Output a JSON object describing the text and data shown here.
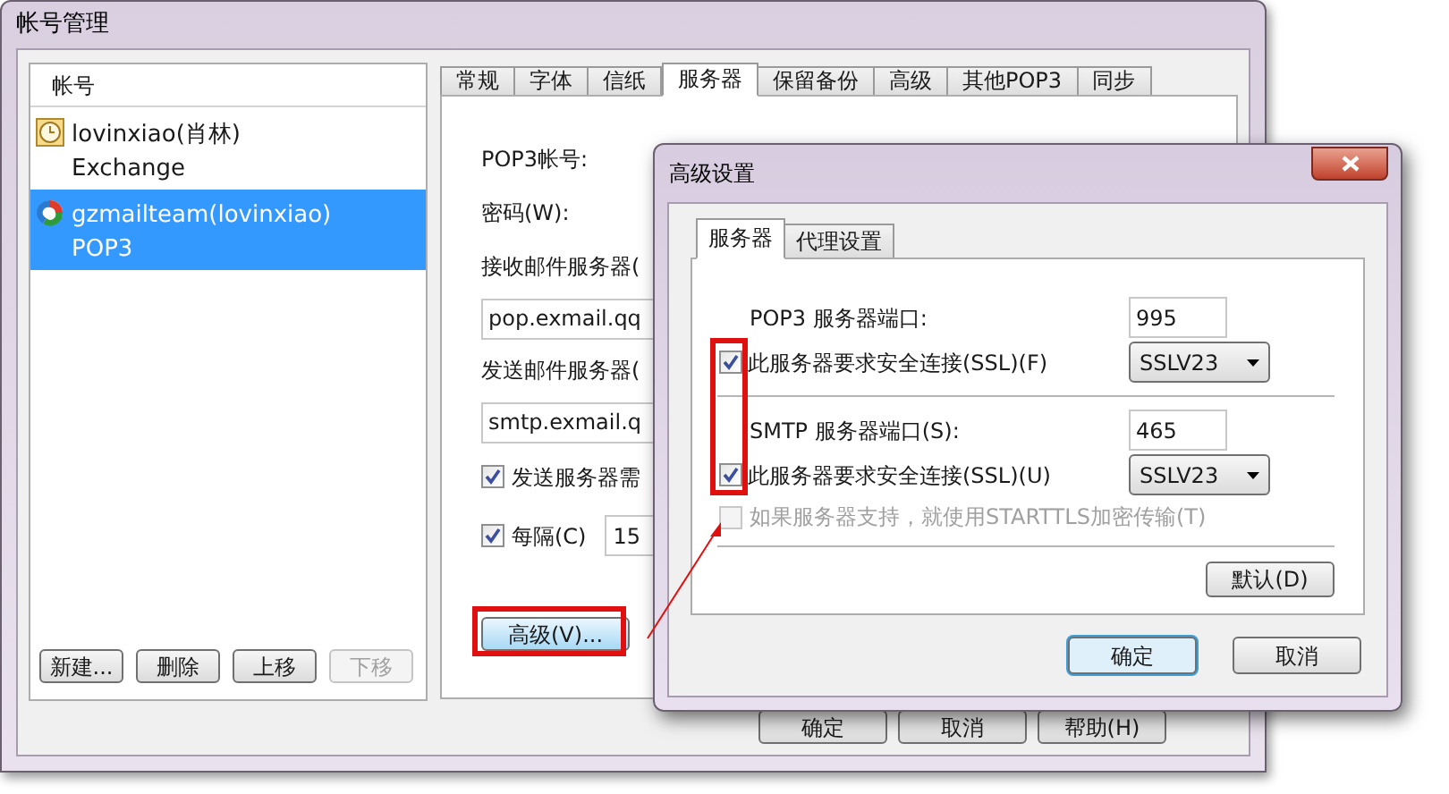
{
  "window": {
    "title": "帐号管理"
  },
  "accounts": {
    "header": "帐号",
    "items": [
      {
        "kind": "exchange",
        "name": "lovinxiao(肖林)",
        "type": "Exchange",
        "selected": false
      },
      {
        "kind": "pop3",
        "name": "gzmailteam(lovinxiao)",
        "type": "POP3",
        "selected": true
      }
    ],
    "buttons": [
      {
        "label": "新建...",
        "disabled": false
      },
      {
        "label": "删除",
        "disabled": false
      },
      {
        "label": "上移",
        "disabled": false
      },
      {
        "label": "下移",
        "disabled": true
      }
    ]
  },
  "tabs": [
    {
      "label": "常规",
      "selected": false
    },
    {
      "label": "字体",
      "selected": false
    },
    {
      "label": "信纸",
      "selected": false
    },
    {
      "label": "服务器",
      "selected": true
    },
    {
      "label": "保留备份",
      "selected": false
    },
    {
      "label": "高级",
      "selected": false
    },
    {
      "label": "其他POP3",
      "selected": false
    },
    {
      "label": "同步",
      "selected": false
    }
  ],
  "server_form": {
    "rows": [
      {
        "kind": "label",
        "text": "POP3帐号:"
      },
      {
        "kind": "label",
        "text": "密码(W):"
      },
      {
        "kind": "label",
        "text": "接收邮件服务器("
      },
      {
        "kind": "input",
        "value": "pop.exmail.qq"
      },
      {
        "kind": "label",
        "text": "发送邮件服务器("
      },
      {
        "kind": "input",
        "value": "smtp.exmail.q"
      },
      {
        "kind": "checkbox",
        "label": "发送服务器需",
        "checked": true
      },
      {
        "kind": "interval",
        "label": "每隔(C)",
        "checked": true,
        "value": "15"
      }
    ],
    "advanced_button": "高级(V)..."
  },
  "footer_buttons": [
    {
      "label": "确定"
    },
    {
      "label": "取消"
    },
    {
      "label": "帮助(H)"
    }
  ],
  "dialog": {
    "title": "高级设置",
    "tabs": [
      {
        "label": "服务器",
        "selected": true
      },
      {
        "label": "代理设置",
        "selected": false
      }
    ],
    "sections": [
      {
        "port_label": "POP3 服务器端口:",
        "port": "995",
        "ssl_label": "此服务器要求安全连接(SSL)(F)",
        "ssl_checked": true,
        "ssl_version": "SSLV23"
      },
      {
        "port_label": "SMTP 服务器端口(S):",
        "port": "465",
        "ssl_label": "此服务器要求安全连接(SSL)(U)",
        "ssl_checked": true,
        "ssl_version": "SSLV23"
      }
    ],
    "starttls": {
      "label": "如果服务器支持，就使用STARTTLS加密传输(T)",
      "checked": false,
      "disabled": true
    },
    "default_button": "默认(D)",
    "buttons": [
      {
        "label": "确定",
        "default": true
      },
      {
        "label": "取消",
        "default": false
      }
    ]
  }
}
